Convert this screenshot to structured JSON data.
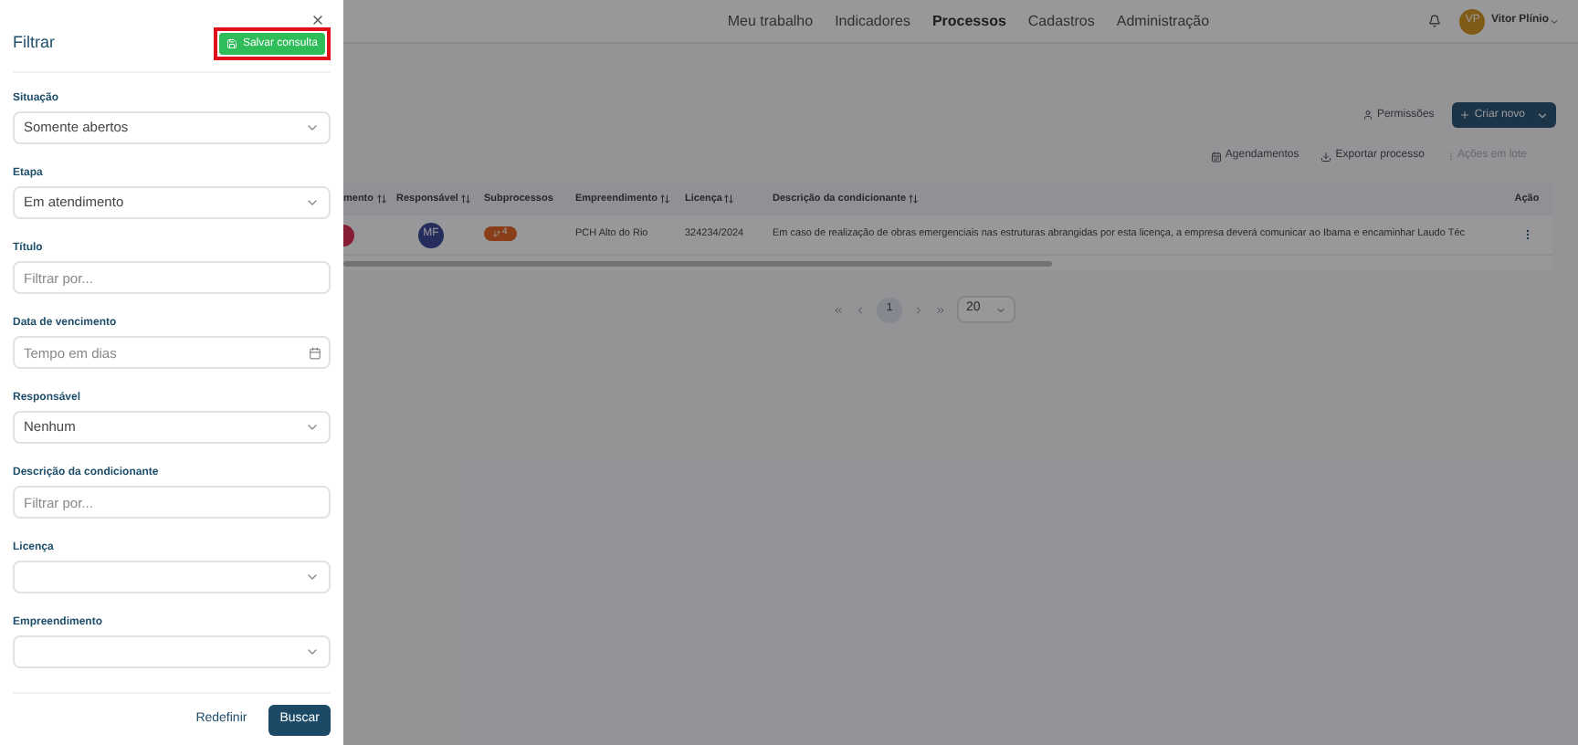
{
  "filter_panel": {
    "title": "Filtrar",
    "save_button": "Salvar consulta",
    "fields": [
      {
        "label": "Situação",
        "kind": "select",
        "value": "Somente abertos"
      },
      {
        "label": "Etapa",
        "kind": "select",
        "value": "Em atendimento"
      },
      {
        "label": "Título",
        "kind": "input",
        "placeholder": "Filtrar por..."
      },
      {
        "label": "Data de vencimento",
        "kind": "date",
        "placeholder": "Tempo em dias"
      },
      {
        "label": "Responsável",
        "kind": "select",
        "value": "Nenhum"
      },
      {
        "label": "Descrição da condicionante",
        "kind": "input",
        "placeholder": "Filtrar por..."
      },
      {
        "label": "Licença",
        "kind": "select"
      },
      {
        "label": "Empreendimento",
        "kind": "select"
      }
    ],
    "reset_button": "Redefinir",
    "search_button": "Buscar"
  },
  "nav": {
    "items": [
      {
        "label": "Meu trabalho",
        "selected": false
      },
      {
        "label": "Indicadores",
        "selected": false
      },
      {
        "label": "Processos",
        "selected": true
      },
      {
        "label": "Cadastros",
        "selected": false
      },
      {
        "label": "Administração",
        "selected": false
      }
    ],
    "user_initials": "VP",
    "user_name": "Vitor Plínio"
  },
  "toolbar": {
    "permissions": "Permissões",
    "create": "Criar novo",
    "schedules": "Agendamentos",
    "export": "Exportar processo",
    "batch": "Ações em lote"
  },
  "table": {
    "columns": [
      "mento",
      "Responsável",
      "Subprocessos",
      "Empreendimento",
      "Licença",
      "Descrição da condicionante",
      "Ação"
    ],
    "rows": [
      {
        "owner": "MF",
        "subprocesses": "4",
        "project": "PCH Alto do Rio",
        "license": "324234/2024",
        "description": "Em caso de realização de obras emergenciais nas estruturas abrangidas por esta licença, a empresa deverá comunicar ao Ibama e encaminhar Laudo Téc"
      }
    ]
  },
  "pagination": {
    "pages": [
      {
        "label": "1",
        "selected": true
      }
    ],
    "page_size": "20"
  }
}
